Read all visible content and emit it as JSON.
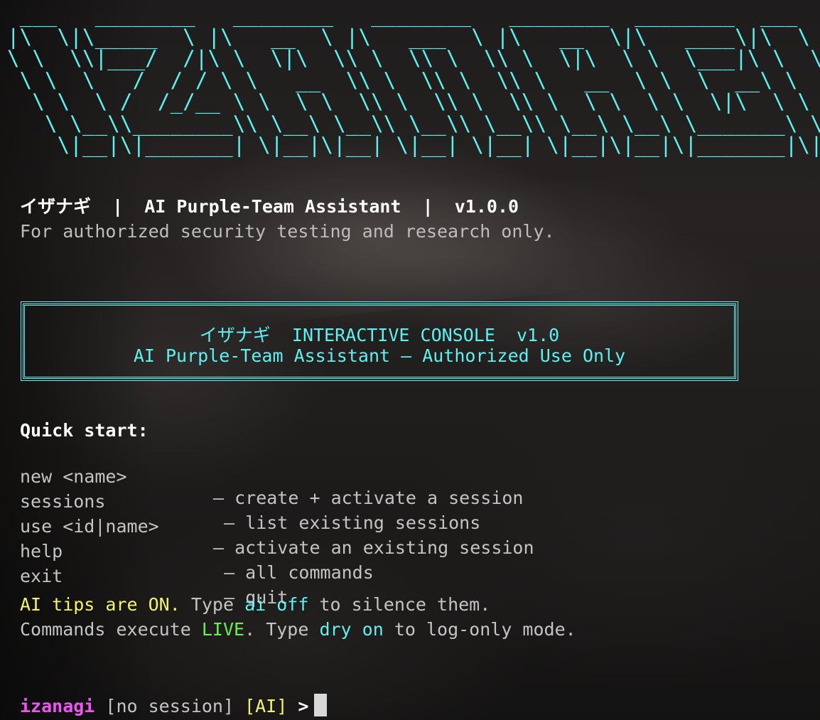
{
  "banner": {
    "ascii_lines": [
      " ___   ________   ________   ________   ________  ________  ___",
      "|\\  \\|\\_____  \\ |\\   __  \\ |\\   ___  \\ |\\   __  \\|\\   ____\\|\\  \\",
      "\\ \\  \\\\|___/  /|\\ \\  \\|\\  \\\\ \\  \\\\ \\  \\\\ \\  \\|\\  \\ \\  \\___|\\ \\  \\",
      " \\ \\  \\   /  / / \\ \\   __  \\\\ \\  \\\\ \\  \\\\ \\   __  \\ \\  \\  __\\ \\  \\",
      "  \\ \\  \\ /  /_/__ \\ \\  \\ \\  \\\\ \\  \\\\ \\  \\\\ \\  \\ \\  \\ \\  \\|\\  \\ \\  \\",
      "   \\ \\__\\\\________\\\\ \\__\\ \\__\\\\ \\__\\\\ \\__\\\\ \\__\\ \\__\\ \\_______\\ \\__\\",
      "    \\|__|\\|_______| \\|__|\\|__| \\|__| \\|__| \\|__|\\|__|\\|_______|\\|__|"
    ],
    "color": "#5ff0f0"
  },
  "header": {
    "title": "イザナギ  |  AI Purple-Team Assistant  |  v1.0.0",
    "subtitle": "For authorized security testing and research only."
  },
  "console_box": {
    "line1": "イザナギ  INTERACTIVE CONSOLE  v1.0",
    "line2": "AI Purple-Team Assistant — Authorized Use Only"
  },
  "quick_start": {
    "title": "Quick start:",
    "commands": [
      {
        "cmd": "new <name>",
        "desc": "— create + activate a session"
      },
      {
        "cmd": "sessions",
        "desc": " — list existing sessions"
      },
      {
        "cmd": "use <id|name>",
        "desc": "— activate an existing session"
      },
      {
        "cmd": "help",
        "desc": " — all commands"
      },
      {
        "cmd": "exit",
        "desc": " — quit"
      }
    ]
  },
  "tips": {
    "ai_tips_on": "AI tips are ON.",
    "type_1": " Type ",
    "ai_off": "ai off",
    "silence": " to silence them.",
    "commands_execute": "Commands execute ",
    "live": "LIVE",
    "type_2": ". Type ",
    "dry_on": "dry on",
    "log_only": " to log-only mode."
  },
  "prompt": {
    "user": "izanagi",
    "session": " [no session] ",
    "ai_tag": "[AI]",
    "arrow": " >"
  },
  "colors": {
    "accent_cyan": "#5ff0f0",
    "yellow": "#f3f36a",
    "green": "#66ee55",
    "magenta": "#ee55ee",
    "text_gray": "#c4c4c4"
  }
}
